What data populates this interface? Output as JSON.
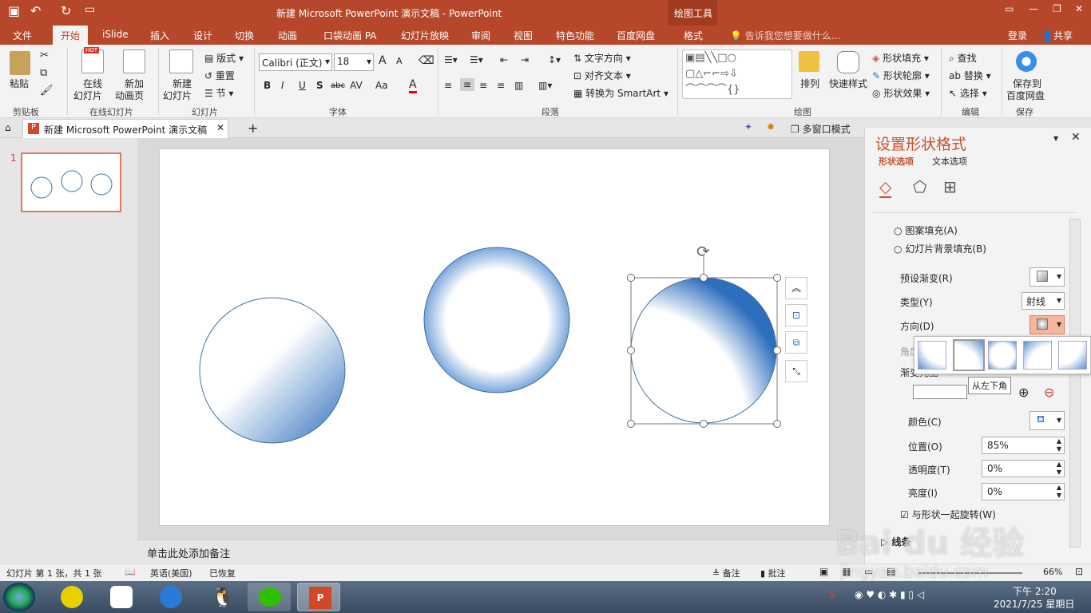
{
  "window": {
    "title": "新建 Microsoft PowerPoint 演示文稿 - PowerPoint",
    "context_tab_group": "绘图工具"
  },
  "tabs": [
    "文件",
    "开始",
    "iSlide",
    "插入",
    "设计",
    "切换",
    "动画",
    "口袋动画 PA",
    "幻灯片放映",
    "审阅",
    "视图",
    "特色功能",
    "百度网盘",
    "格式"
  ],
  "tell_me": "告诉我您想要做什么...",
  "account": {
    "login": "登录",
    "share": "共享"
  },
  "ribbon": {
    "clipboard": {
      "paste": "粘贴",
      "label": "剪贴板"
    },
    "online": {
      "btn1_a": "在线",
      "btn1_b": "幻灯片",
      "btn2_a": "新加",
      "btn2_b": "动画页",
      "label": "在线幻灯片",
      "hot": "HOT"
    },
    "slides": {
      "new_a": "新建",
      "new_b": "幻灯片",
      "layout": "版式",
      "reset": "重置",
      "section": "节",
      "label": "幻灯片"
    },
    "font": {
      "name": "Calibri (正文)",
      "size": "18",
      "bold": "B",
      "italic": "I",
      "underline": "U",
      "shadow": "S",
      "strike": "abc",
      "spacing": "AV",
      "case": "Aa",
      "color": "A",
      "grow": "A",
      "shrink": "A",
      "label": "字体"
    },
    "paragraph": {
      "text_dir": "文字方向",
      "align_text": "对齐文本",
      "smartart": "转换为 SmartArt",
      "label": "段落"
    },
    "drawing": {
      "arrange": "排列",
      "quick_styles": "快速样式",
      "fill": "形状填充",
      "outline": "形状轮廓",
      "effect": "形状效果",
      "label": "绘图"
    },
    "editing": {
      "find": "查找",
      "replace": "替换",
      "select": "选择",
      "label": "编辑"
    },
    "save": {
      "a": "保存到",
      "b": "百度网盘",
      "label": "保存"
    }
  },
  "doc_tab": {
    "name": "新建 Microsoft PowerPoint 演示文稿",
    "multi_window": "多窗口模式"
  },
  "thumbnail": {
    "number": "1"
  },
  "notes": {
    "placeholder": "单击此处添加备注"
  },
  "pane": {
    "title": "设置形状格式",
    "tab_shape": "形状选项",
    "tab_text": "文本选项",
    "pattern_fill": "图案填充(A)",
    "slide_bg_fill": "幻灯片背景填充(B)",
    "preset_gradient": "预设渐变(R)",
    "type_label": "类型(Y)",
    "type_value": "射线",
    "direction_label": "方向(D)",
    "angle_label": "角度",
    "stops_label": "渐变光圈",
    "tooltip": "从左下角",
    "color_label": "颜色(C)",
    "position_label": "位置(O)",
    "position_value": "85%",
    "transparency_label": "透明度(T)",
    "transparency_value": "0%",
    "brightness_label": "亮度(I)",
    "brightness_value": "0%",
    "rotate_with_shape": "与形状一起旋转(W)",
    "line_section": "线条"
  },
  "status": {
    "slide_info": "幻灯片 第 1 张，共 1 张",
    "language": "英语(美国)",
    "recovered": "已恢复",
    "notes": "备注",
    "comments": "批注",
    "zoom": "66%"
  },
  "taskbar": {
    "time": "下午 2:20",
    "date": "2021/7/25 星期日"
  },
  "watermark": {
    "brand": "Bai du 经验",
    "url": "jingyan.baidu.com"
  },
  "colors": {
    "accent": "#b7472a",
    "gradient_blue": "#2e6fbd",
    "outline": "#41719c"
  }
}
